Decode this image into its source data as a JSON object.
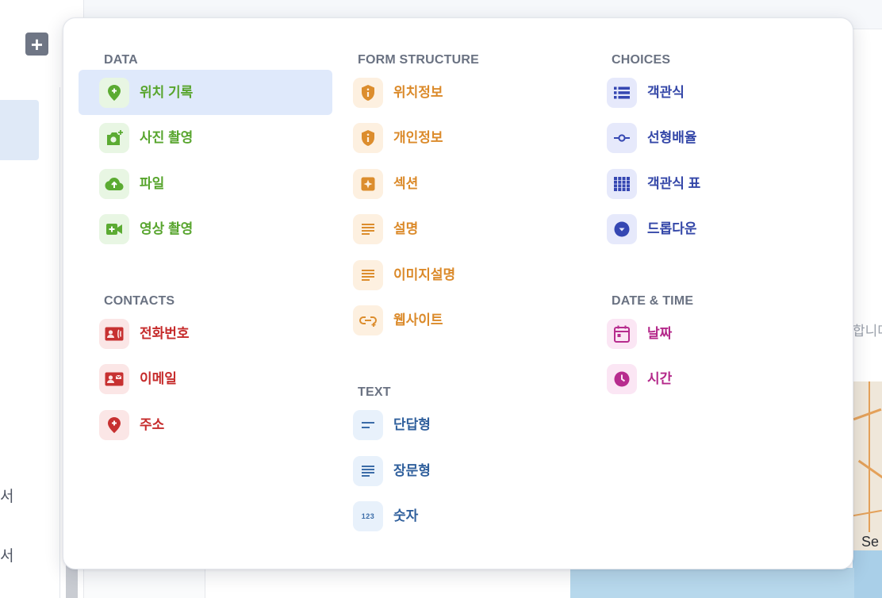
{
  "background": {
    "add_button_glyph": "+",
    "sidebar_text_a": "서",
    "sidebar_text_b": "서",
    "partial_text": "합니다",
    "map_label": "Se"
  },
  "menu": {
    "data": {
      "title": "DATA",
      "items": [
        {
          "label": "위치 기록",
          "icon": "location-plus-icon"
        },
        {
          "label": "사진 촬영",
          "icon": "camera-plus-icon"
        },
        {
          "label": "파일",
          "icon": "cloud-upload-icon"
        },
        {
          "label": "영상 촬영",
          "icon": "video-plus-icon"
        }
      ]
    },
    "contacts": {
      "title": "CONTACTS",
      "items": [
        {
          "label": "전화번호",
          "icon": "contact-phone-icon"
        },
        {
          "label": "이메일",
          "icon": "contact-mail-icon"
        },
        {
          "label": "주소",
          "icon": "location-plus-icon"
        }
      ]
    },
    "form_structure": {
      "title": "FORM STRUCTURE",
      "items": [
        {
          "label": "위치정보",
          "icon": "shield-info-icon"
        },
        {
          "label": "개인정보",
          "icon": "shield-info-icon"
        },
        {
          "label": "섹션",
          "icon": "section-sparkle-icon"
        },
        {
          "label": "설명",
          "icon": "lines-icon"
        },
        {
          "label": "이미지설명",
          "icon": "lines-icon"
        },
        {
          "label": "웹사이트",
          "icon": "link-icon"
        }
      ]
    },
    "text": {
      "title": "TEXT",
      "items": [
        {
          "label": "단답형",
          "icon": "short-text-icon"
        },
        {
          "label": "장문형",
          "icon": "long-text-icon"
        },
        {
          "label": "숫자",
          "icon": "number-123-icon"
        }
      ]
    },
    "choices": {
      "title": "CHOICES",
      "items": [
        {
          "label": "객관식",
          "icon": "list-icon"
        },
        {
          "label": "선형배율",
          "icon": "linear-scale-icon"
        },
        {
          "label": "객관식 표",
          "icon": "grid-icon"
        },
        {
          "label": "드롭다운",
          "icon": "dropdown-circle-icon"
        }
      ]
    },
    "date_time": {
      "title": "DATE & TIME",
      "items": [
        {
          "label": "날짜",
          "icon": "calendar-icon"
        },
        {
          "label": "시간",
          "icon": "clock-icon"
        }
      ]
    },
    "number_icon_text": "123"
  },
  "colors": {
    "data": "#5bab32",
    "contacts": "#c73131",
    "form_structure": "#dc8d2d",
    "text": "#3b6ca8",
    "choices": "#3547b2",
    "date_time": "#b72c8e",
    "selected_bg": "#dfe9fb"
  }
}
